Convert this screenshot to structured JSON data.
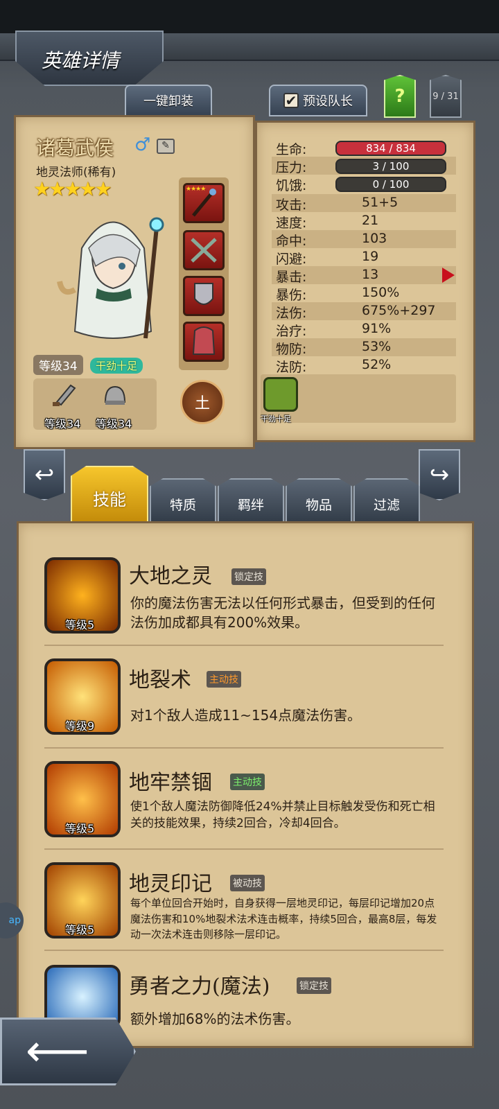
{
  "header": {
    "title": "英雄详情"
  },
  "top_buttons": {
    "unequip_all": "一键卸装",
    "preset_captain": "预设队长",
    "preset_checked": "✔",
    "help": "?",
    "hero_count": "9 / 31"
  },
  "hero": {
    "name": "诸葛武侯",
    "gender_symbol": "♂",
    "class": "地灵法师(稀有)",
    "stars": "★★★★★",
    "level": "等级34",
    "status": "干劲十足",
    "weapon_level": "等级34",
    "armor_level": "等级34",
    "element": "土",
    "equipment_icons": [
      "staff-icon",
      "crossed-blades-icon",
      "shield-icon",
      "cloak-icon"
    ]
  },
  "stats": {
    "hp_label": "生命:",
    "hp_value": "834 / 834",
    "stress_label": "压力:",
    "stress_value": "3 / 100",
    "hunger_label": "饥饿:",
    "hunger_value": "0 / 100",
    "rows": [
      {
        "label": "攻击:",
        "value": "51+5"
      },
      {
        "label": "速度:",
        "value": "21"
      },
      {
        "label": "命中:",
        "value": "103"
      },
      {
        "label": "闪避:",
        "value": "19"
      },
      {
        "label": "暴击:",
        "value": "13"
      },
      {
        "label": "暴伤:",
        "value": "150%"
      },
      {
        "label": "法伤:",
        "value": "675%+297"
      },
      {
        "label": "治疗:",
        "value": "91%"
      },
      {
        "label": "物防:",
        "value": "53%"
      },
      {
        "label": "法防:",
        "value": "52%"
      }
    ],
    "trait_label": "干劲十足"
  },
  "tabs": [
    "技能",
    "特质",
    "羁绊",
    "物品",
    "过滤"
  ],
  "skills": [
    {
      "name": "大地之灵",
      "type": "锁定技",
      "level": "等级5",
      "desc": "你的魔法伤害无法以任何形式暴击，但受到的任何法伤加成都具有200%效果。"
    },
    {
      "name": "地裂术",
      "type": "主动技",
      "level": "等级9",
      "desc": "对1个敌人造成11~154点魔法伤害。"
    },
    {
      "name": "地牢禁锢",
      "type": "主动技",
      "level": "等级5",
      "desc": "使1个敌人魔法防御降低24%并禁止目标触发受伤和死亡相关的技能效果，持续2回合，冷却4回合。"
    },
    {
      "name": "地灵印记",
      "type": "被动技",
      "level": "等级5",
      "desc": "每个单位回合开始时，自身获得一层地灵印记，每层印记增加20点魔法伤害和10%地裂术法术连击概率，持续5回合，最高8层，每发动一次法术连击则移除一层印记。"
    },
    {
      "name": "勇者之力(魔法)",
      "type": "锁定技",
      "level": "",
      "desc": "额外增加68%的法术伤害。"
    }
  ],
  "nav": {
    "prev": "↩",
    "next": "↪",
    "back": "⟵"
  },
  "side_bubble": "ap"
}
